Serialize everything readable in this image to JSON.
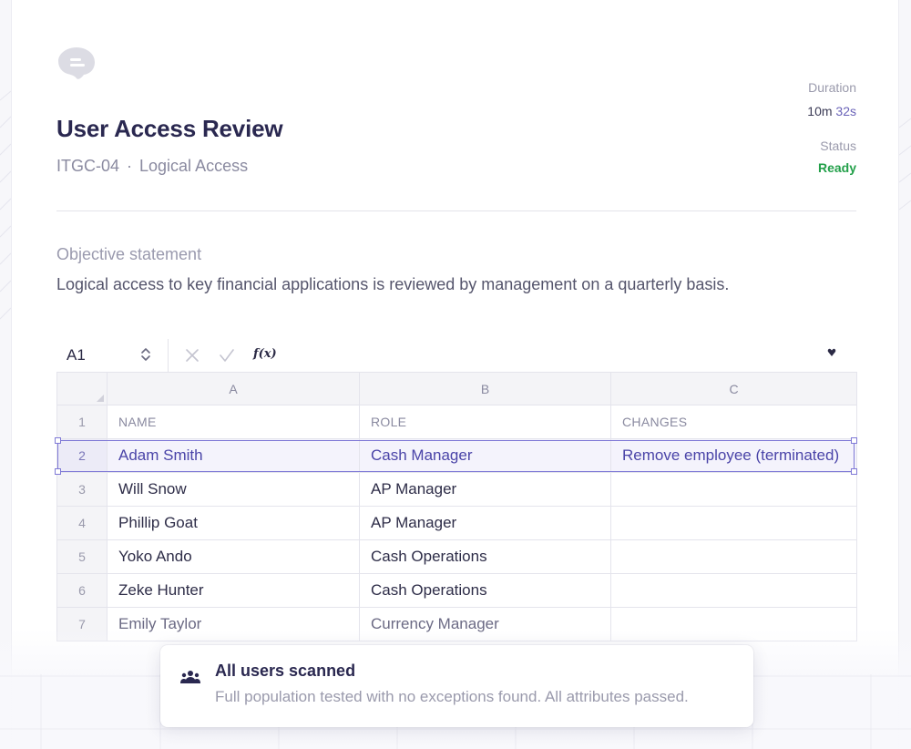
{
  "header": {
    "title": "User Access Review",
    "control_id": "ITGC-04",
    "separator": "·",
    "category": "Logical Access"
  },
  "meta": {
    "duration_label": "Duration",
    "duration_min": "10m",
    "duration_sec": "32s",
    "status_label": "Status",
    "status_value": "Ready",
    "status_color": "#23a04a"
  },
  "objective": {
    "label": "Objective statement",
    "text": "Logical access to key financial applications is reviewed by management on a quarterly basis."
  },
  "spreadsheet": {
    "cell_ref": "A1",
    "fx_label": "f(x)",
    "columns": [
      "A",
      "B",
      "C"
    ],
    "header_row": {
      "num": "1",
      "name": "NAME",
      "role": "ROLE",
      "changes": "CHANGES"
    },
    "rows": [
      {
        "num": "2",
        "name": "Adam Smith",
        "role": "Cash Manager",
        "changes": "Remove employee (terminated)"
      },
      {
        "num": "3",
        "name": "Will Snow",
        "role": "AP Manager",
        "changes": ""
      },
      {
        "num": "4",
        "name": "Phillip Goat",
        "role": "AP Manager",
        "changes": ""
      },
      {
        "num": "5",
        "name": "Yoko Ando",
        "role": "Cash Operations",
        "changes": ""
      },
      {
        "num": "6",
        "name": "Zeke Hunter",
        "role": "Cash Operations",
        "changes": ""
      },
      {
        "num": "7",
        "name": "Emily Taylor",
        "role": "Currency Manager",
        "changes": ""
      }
    ],
    "selection_color": "#7f79d6"
  },
  "toast": {
    "icon": "users-icon",
    "title": "All users scanned",
    "message": "Full population tested with no exceptions found. All attributes passed."
  }
}
